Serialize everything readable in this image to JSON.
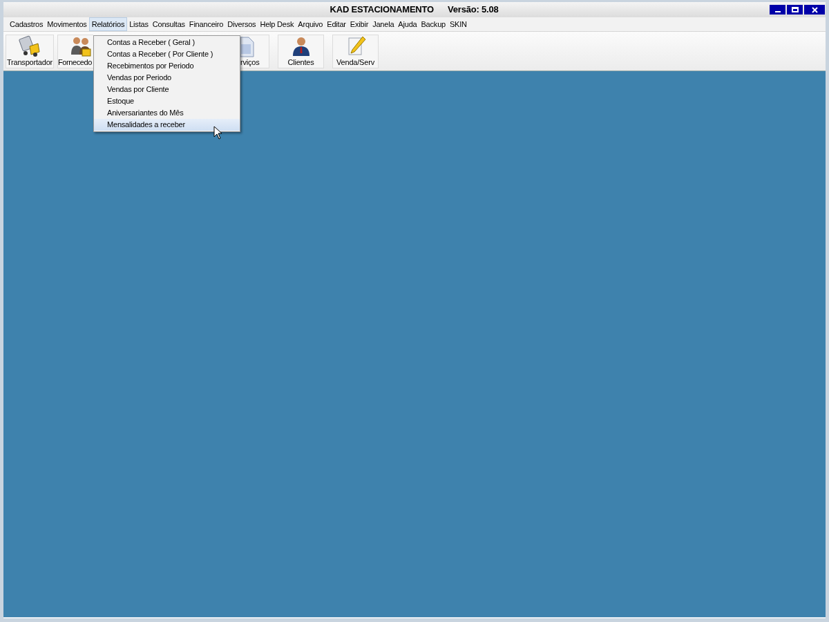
{
  "window": {
    "title": "KAD ESTACIONAMENTO",
    "version": "Versão: 5.08"
  },
  "menu_bar": [
    {
      "label": "Cadastros",
      "selected": false
    },
    {
      "label": "Movimentos",
      "selected": false
    },
    {
      "label": "Relatórios",
      "selected": true
    },
    {
      "label": "Listas",
      "selected": false
    },
    {
      "label": "Consultas",
      "selected": false
    },
    {
      "label": "Financeiro",
      "selected": false
    },
    {
      "label": "Diversos",
      "selected": false
    },
    {
      "label": "Help Desk",
      "selected": false
    },
    {
      "label": "Arquivo",
      "selected": false
    },
    {
      "label": "Editar",
      "selected": false
    },
    {
      "label": "Exibir",
      "selected": false
    },
    {
      "label": "Janela",
      "selected": false
    },
    {
      "label": "Ajuda",
      "selected": false
    },
    {
      "label": "Backup",
      "selected": false
    },
    {
      "label": "SKIN",
      "selected": false
    }
  ],
  "toolbar": [
    {
      "label": "Transportador",
      "kind": "truck"
    },
    {
      "label": "Fornecedo",
      "kind": "people"
    },
    {
      "label": "rviços",
      "kind": "document"
    },
    {
      "label": "Clientes",
      "kind": "person"
    },
    {
      "label": "Venda/Serv",
      "kind": "pencil"
    }
  ],
  "dropdown": [
    {
      "label": "Contas a Receber ( Geral )",
      "selected": false
    },
    {
      "label": "Contas a Receber ( Por Cliente )",
      "selected": false
    },
    {
      "label": "Recebimentos por Periodo",
      "selected": false
    },
    {
      "label": "Vendas por Periodo",
      "selected": false
    },
    {
      "label": "Vendas por Cliente",
      "selected": false
    },
    {
      "label": "Estoque",
      "selected": false
    },
    {
      "label": "Aniversariantes do Mês",
      "selected": false
    },
    {
      "label": "Mensalidades a receber",
      "selected": true
    }
  ]
}
